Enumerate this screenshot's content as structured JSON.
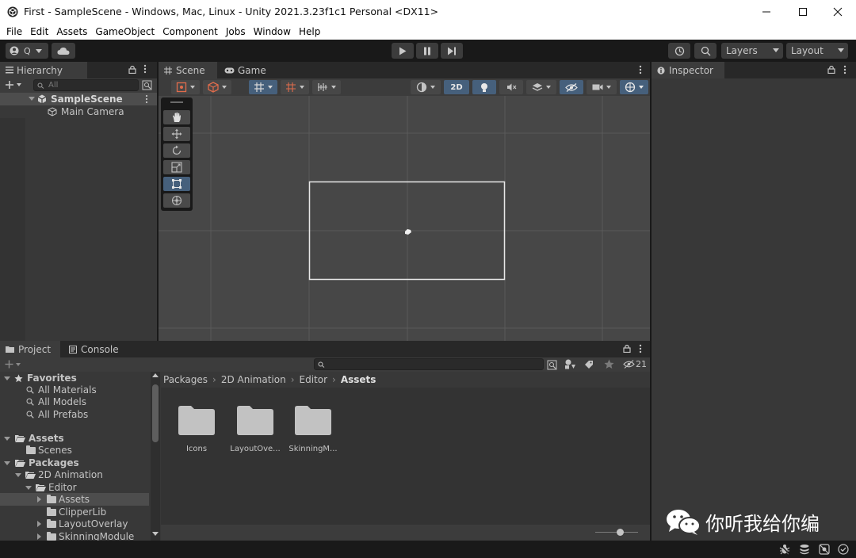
{
  "window": {
    "title": "First - SampleScene - Windows, Mac, Linux - Unity 2021.3.23f1c1 Personal <DX11>",
    "controls": [
      "minimize-icon",
      "maximize-icon",
      "close-icon"
    ]
  },
  "menu": [
    "File",
    "Edit",
    "Assets",
    "GameObject",
    "Component",
    "Jobs",
    "Window",
    "Help"
  ],
  "toolbar": {
    "account_label": "Q",
    "layers_label": "Layers",
    "layout_label": "Layout",
    "play_icons": [
      "play-icon",
      "pause-icon",
      "step-icon"
    ]
  },
  "hierarchy": {
    "tab_label": "Hierarchy",
    "search_placeholder": "All",
    "scene_name": "SampleScene",
    "items": [
      "Main Camera"
    ]
  },
  "scene_view": {
    "tabs": [
      "Scene",
      "Game"
    ],
    "active_tab": "Scene",
    "mode_2d_label": "2D",
    "hidden_count": "",
    "tools": [
      "hand-tool-icon",
      "move-tool-icon",
      "rotate-tool-icon",
      "scale-tool-icon",
      "rect-tool-icon",
      "transform-tool-icon"
    ],
    "active_tool": "rect-tool-icon"
  },
  "inspector": {
    "tab_label": "Inspector"
  },
  "project": {
    "tabs": [
      "Project",
      "Console"
    ],
    "active_tab": "Project",
    "hidden_count": "21",
    "breadcrumb": [
      "Packages",
      "2D Animation",
      "Editor",
      "Assets"
    ],
    "tree": {
      "favorites_label": "Favorites",
      "favorites": [
        "All Materials",
        "All Models",
        "All Prefabs"
      ],
      "assets_label": "Assets",
      "assets_children": [
        "Scenes"
      ],
      "packages_label": "Packages",
      "package_2d_animation": "2D Animation",
      "editor_label": "Editor",
      "editor_children": [
        "Assets",
        "ClipperLib",
        "LayoutOverlay",
        "SkinningModule"
      ],
      "selected": "Assets"
    },
    "assets": [
      "Icons",
      "LayoutOve...",
      "SkinningM..."
    ]
  },
  "watermark": {
    "text": "你听我给你编"
  },
  "colors": {
    "editor_bg": "#191919",
    "panel_bg": "#383838",
    "scene_bg": "#474747",
    "accent_blue": "#46607c",
    "text": "#c4c4c4"
  }
}
